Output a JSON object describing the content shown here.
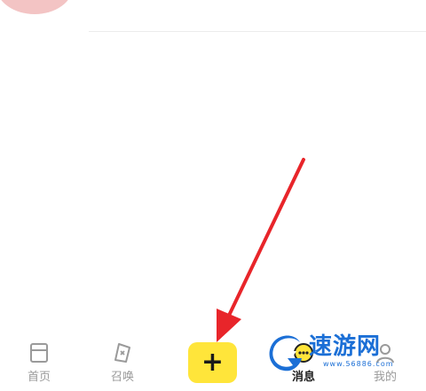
{
  "tabbar": {
    "items": [
      {
        "label": "首页",
        "icon": "home-icon",
        "active": false
      },
      {
        "label": "召唤",
        "icon": "summon-icon",
        "active": false
      },
      {
        "label": "消息",
        "icon": "message-icon",
        "active": true
      },
      {
        "label": "我的",
        "icon": "profile-icon",
        "active": false
      }
    ],
    "add_button": {
      "label": "+",
      "color": "#ffe53a"
    }
  },
  "watermark": {
    "name": "速游网",
    "domain": "www.56886.com",
    "color": "#1b6fd6"
  },
  "annotation": {
    "arrow_color": "#e8252a"
  }
}
